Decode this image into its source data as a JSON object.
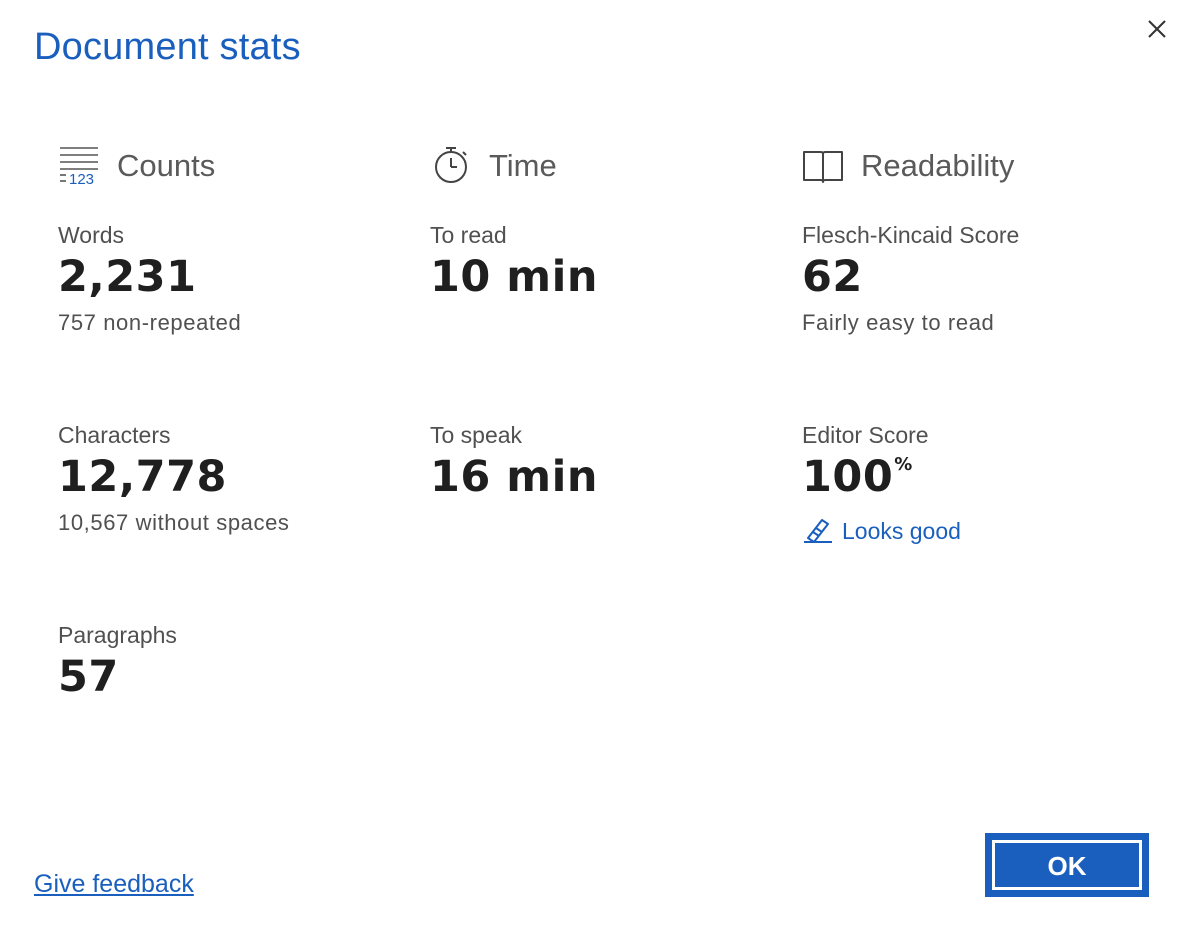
{
  "dialog": {
    "title": "Document stats",
    "close_icon": "close-icon"
  },
  "counts": {
    "header": "Counts",
    "icon": "counts-icon",
    "icon_text": "123",
    "words": {
      "label": "Words",
      "value": "2,231",
      "sub": "757 non-repeated"
    },
    "characters": {
      "label": "Characters",
      "value": "12,778",
      "sub": "10,567 without spaces"
    },
    "paragraphs": {
      "label": "Paragraphs",
      "value": "57"
    }
  },
  "time": {
    "header": "Time",
    "icon": "stopwatch-icon",
    "to_read": {
      "label": "To read",
      "value": "10 min"
    },
    "to_speak": {
      "label": "To speak",
      "value": "16 min"
    }
  },
  "readability": {
    "header": "Readability",
    "icon": "book-icon",
    "flesch_kincaid": {
      "label": "Flesch-Kincaid Score",
      "value": "62",
      "sub": "Fairly easy to read"
    },
    "editor_score": {
      "label": "Editor Score",
      "value": "100",
      "unit": "%",
      "status_icon": "editor-pen-icon",
      "status": "Looks good"
    }
  },
  "footer": {
    "feedback_link": "Give feedback",
    "ok_label": "OK"
  },
  "colors": {
    "accent": "#1b5fbe",
    "header_text": "#5a5a5a",
    "label_text": "#505050",
    "value_text": "#1f1f1f"
  }
}
